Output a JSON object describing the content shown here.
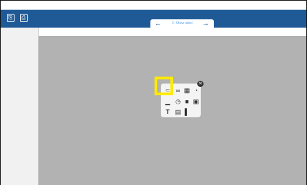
{
  "header": {
    "nav_title": "2: Show label",
    "left_arrow": "←",
    "right_arrow": "→",
    "button1": "⎘",
    "button2": "⎙"
  },
  "popup": {
    "close": "✕",
    "icons": [
      {
        "name": "scatter-icon",
        "glyph": "⸦"
      },
      {
        "name": "link-icon",
        "glyph": "∞"
      },
      {
        "name": "table-icon",
        "glyph": "▦"
      },
      {
        "name": "gauge-icon",
        "glyph": "◔"
      },
      {
        "name": "line-chart-icon",
        "glyph": "▁"
      },
      {
        "name": "timer-icon",
        "glyph": "◷"
      },
      {
        "name": "video-icon",
        "glyph": "■"
      },
      {
        "name": "calculator-icon",
        "glyph": "▣"
      },
      {
        "name": "text-icon",
        "glyph": "T"
      },
      {
        "name": "document-icon",
        "glyph": "▤"
      },
      {
        "name": "bar-chart-icon",
        "glyph": "▌"
      }
    ]
  }
}
